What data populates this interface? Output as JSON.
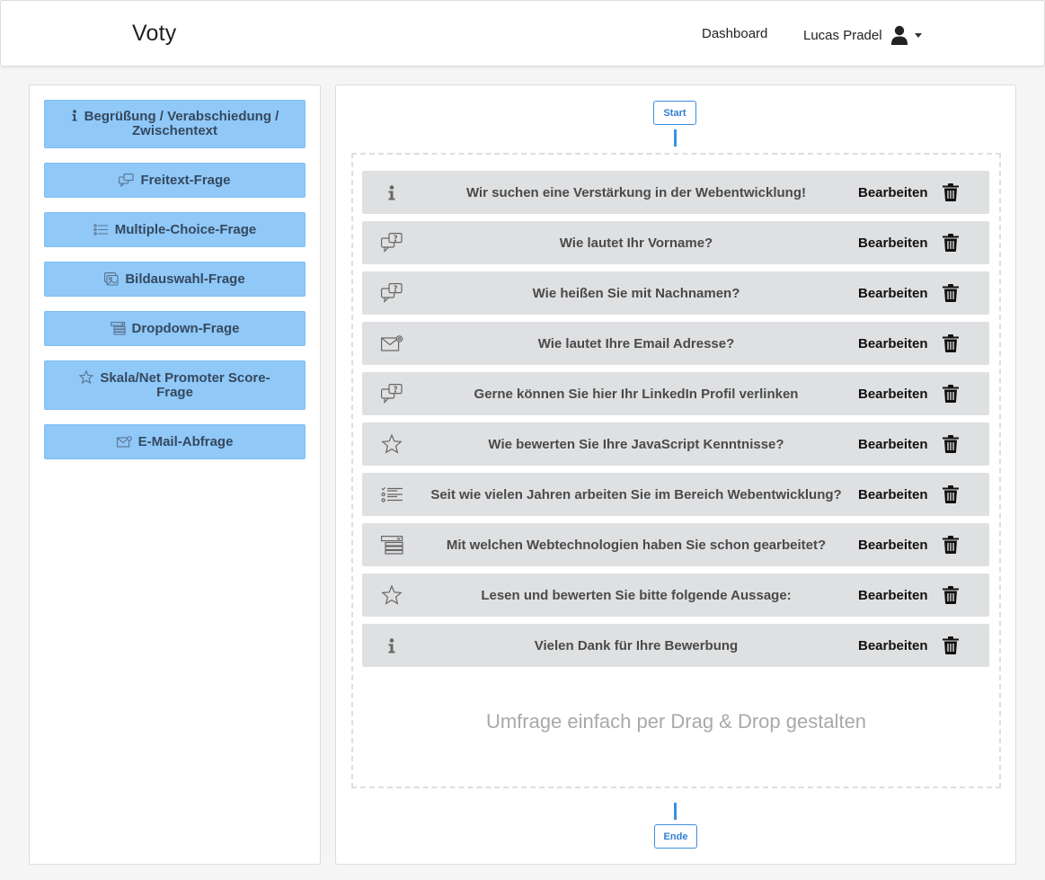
{
  "app": {
    "brand": "Voty"
  },
  "nav": {
    "dashboard": "Dashboard",
    "user_name": "Lucas Pradel"
  },
  "sidebar": {
    "items": [
      {
        "label": "Begrüßung / Verabschiedung / Zwischentext",
        "icon": "info-icon"
      },
      {
        "label": "Freitext-Frage",
        "icon": "speech-bubble-icon"
      },
      {
        "label": "Multiple-Choice-Frage",
        "icon": "list-icon"
      },
      {
        "label": "Bildauswahl-Frage",
        "icon": "image-icon"
      },
      {
        "label": "Dropdown-Frage",
        "icon": "dropdown-icon"
      },
      {
        "label": "Skala/Net Promoter Score-Frage",
        "icon": "star-icon"
      },
      {
        "label": "E-Mail-Abfrage",
        "icon": "envelope-icon"
      }
    ]
  },
  "flow": {
    "start": "Start",
    "end": "Ende"
  },
  "questions": [
    {
      "text": "Wir suchen eine Verstärkung in der Webentwicklung!",
      "icon": "info-icon"
    },
    {
      "text": "Wie lautet Ihr Vorname?",
      "icon": "speech-bubble-icon"
    },
    {
      "text": "Wie heißen Sie mit Nachnamen?",
      "icon": "speech-bubble-icon"
    },
    {
      "text": "Wie lautet Ihre Email Adresse?",
      "icon": "envelope-icon"
    },
    {
      "text": "Gerne können Sie hier Ihr LinkedIn Profil verlinken",
      "icon": "speech-bubble-icon"
    },
    {
      "text": "Wie bewerten Sie Ihre JavaScript Kenntnisse?",
      "icon": "star-icon"
    },
    {
      "text": "Seit wie vielen Jahren arbeiten Sie im Bereich Webentwicklung?",
      "icon": "list-icon"
    },
    {
      "text": "Mit welchen Webtechnologien haben Sie schon gearbeitet?",
      "icon": "dropdown-icon"
    },
    {
      "text": "Lesen und bewerten Sie bitte folgende Aussage:",
      "icon": "star-icon"
    },
    {
      "text": "Vielen Dank für Ihre Bewerbung",
      "icon": "info-icon"
    }
  ],
  "edit_label": "Bearbeiten",
  "hint": "Umfrage einfach per Drag & Drop gestalten",
  "colors": {
    "tool_bg": "#90c8f8",
    "row_bg": "#dfe0e2",
    "accent": "#3d8ee0"
  }
}
